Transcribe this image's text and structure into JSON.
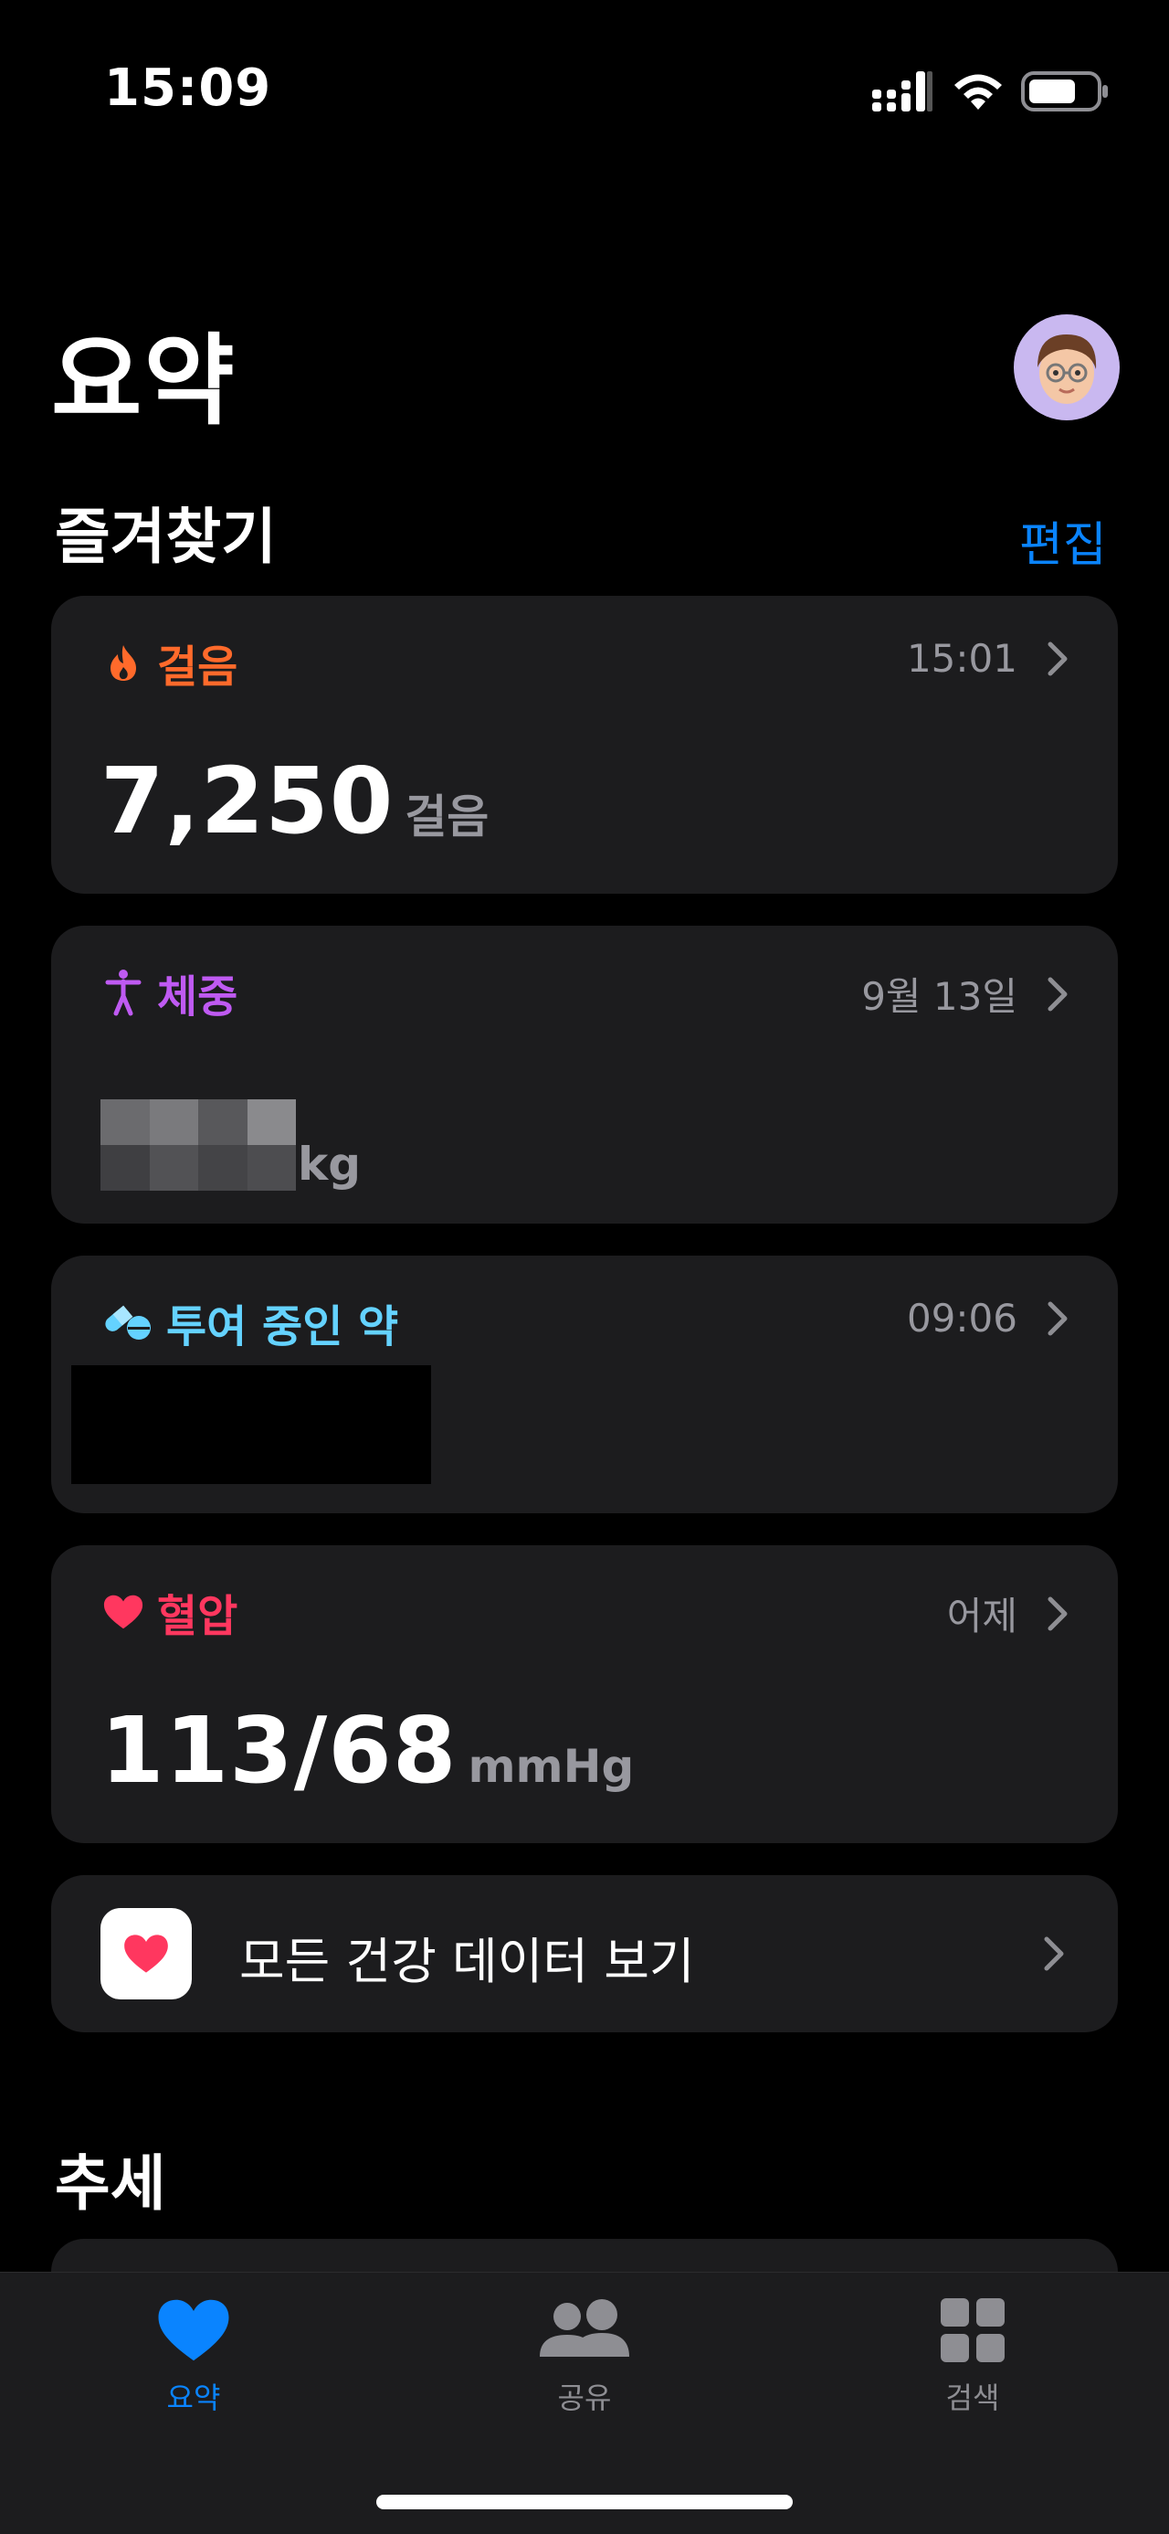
{
  "status_bar": {
    "time": "15:09"
  },
  "header": {
    "title": "요약"
  },
  "favorites": {
    "title": "즐겨찾기",
    "edit_label": "편집",
    "steps": {
      "title": "걸음",
      "time": "15:01",
      "value": "7,250",
      "unit": "걸음",
      "color": "#ff6a2b"
    },
    "weight": {
      "title": "체중",
      "date": "9월 13일",
      "unit": "kg",
      "color": "#bf5af2"
    },
    "medications": {
      "title": "투여 중인 약",
      "time": "09:06",
      "color": "#64d2ff"
    },
    "blood_pressure": {
      "title": "혈압",
      "date": "어제",
      "value": "113/68",
      "unit": "mmHg",
      "color": "#ff375f"
    }
  },
  "all_data": {
    "label": "모든 건강 데이터 보기"
  },
  "trends": {
    "title": "추세"
  },
  "tab_bar": {
    "tabs": [
      {
        "label": "요약",
        "icon": "heart-icon",
        "active": true
      },
      {
        "label": "공유",
        "icon": "people-icon",
        "active": false
      },
      {
        "label": "검색",
        "icon": "grid-icon",
        "active": false
      }
    ],
    "active_color": "#0a84ff",
    "inactive_color": "#8e8e93"
  }
}
